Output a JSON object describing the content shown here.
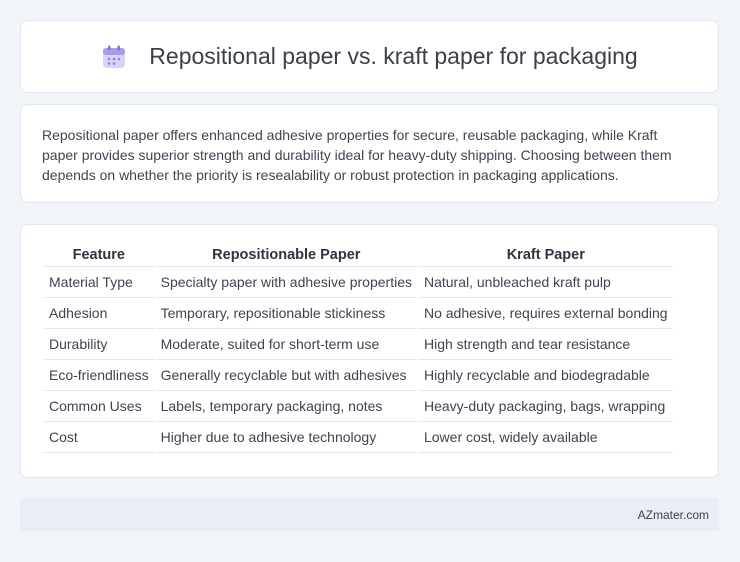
{
  "header": {
    "title": "Repositional paper vs. kraft paper for packaging",
    "icon": "calendar-icon"
  },
  "summary": {
    "text": "Repositional paper offers enhanced adhesive properties for secure, reusable packaging, while Kraft paper provides superior strength and durability ideal for heavy-duty shipping. Choosing between them depends on whether the priority is resealability or robust protection in packaging applications."
  },
  "table": {
    "headers": [
      "Feature",
      "Repositionable Paper",
      "Kraft Paper"
    ],
    "rows": [
      [
        "Material Type",
        "Specialty paper with adhesive properties",
        "Natural, unbleached kraft pulp"
      ],
      [
        "Adhesion",
        "Temporary, repositionable stickiness",
        "No adhesive, requires external bonding"
      ],
      [
        "Durability",
        "Moderate, suited for short-term use",
        "High strength and tear resistance"
      ],
      [
        "Eco-friendliness",
        "Generally recyclable but with adhesives",
        "Highly recyclable and biodegradable"
      ],
      [
        "Common Uses",
        "Labels, temporary packaging, notes",
        "Heavy-duty packaging, bags, wrapping"
      ],
      [
        "Cost",
        "Higher due to adhesive technology",
        "Lower cost, widely available"
      ]
    ]
  },
  "footer": {
    "brand": "AZmater.com"
  }
}
